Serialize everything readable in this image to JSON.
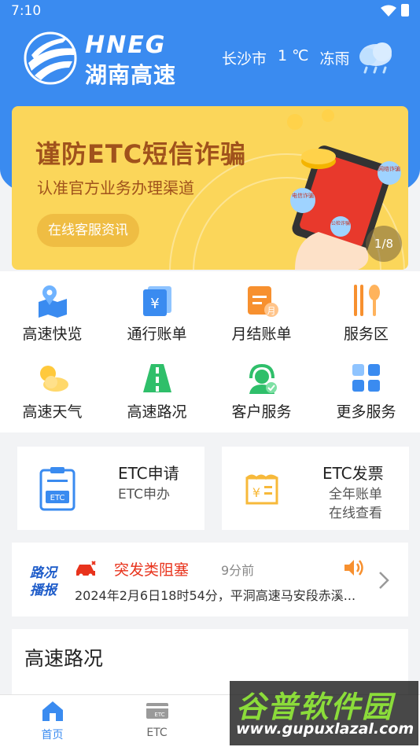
{
  "status_bar": {
    "time": "7:10"
  },
  "brand": {
    "name_en": "HNEG",
    "name_cn": "湖南高速"
  },
  "weather": {
    "city": "长沙市",
    "temperature": "1 ℃",
    "condition": "冻雨",
    "icon": "sleet-cloud-icon"
  },
  "banner": {
    "title": "谨防ETC短信诈骗",
    "subtitle": "认准官方业务办理渠道",
    "cta": "在线客服资讯",
    "pager": "1/8",
    "art_labels": [
      "电信诈骗",
      "网络诈骗",
      "公检诈骗"
    ]
  },
  "services": [
    {
      "label": "高速快览",
      "icon": "map-pin-icon"
    },
    {
      "label": "通行账单",
      "icon": "yuan-bill-icon"
    },
    {
      "label": "月结账单",
      "icon": "monthly-bill-icon"
    },
    {
      "label": "服务区",
      "icon": "fork-spoon-icon"
    },
    {
      "label": "高速天气",
      "icon": "sun-cloud-icon"
    },
    {
      "label": "高速路况",
      "icon": "road-icon"
    },
    {
      "label": "客户服务",
      "icon": "headset-icon"
    },
    {
      "label": "更多服务",
      "icon": "grid-icon"
    }
  ],
  "cards": {
    "etc_apply": {
      "title": "ETC申请",
      "sub": "ETC申办",
      "icon_text": "ETC"
    },
    "etc_invoice": {
      "title": "ETC发票",
      "sub1": "全年账单",
      "sub2": "在线查看"
    }
  },
  "road_news": {
    "badge_line1": "路况",
    "badge_line2": "播报",
    "type": "突发类阻塞",
    "ago": "9分前",
    "text": "2024年2月6日18时54分，平洞高速马安段赤溪..."
  },
  "section": {
    "title": "高速路况"
  },
  "tabbar": [
    {
      "label": "首页",
      "icon": "home-icon",
      "active": true
    },
    {
      "label": "ETC",
      "icon": "etc-card-icon",
      "active": false
    }
  ],
  "watermark": {
    "cn": "谷普软件园",
    "url": "www.gupuxlazal.com"
  },
  "colors": {
    "primary": "#3a8bf0",
    "banner_bg": "#fbd65a",
    "alert_red": "#e8331c"
  }
}
